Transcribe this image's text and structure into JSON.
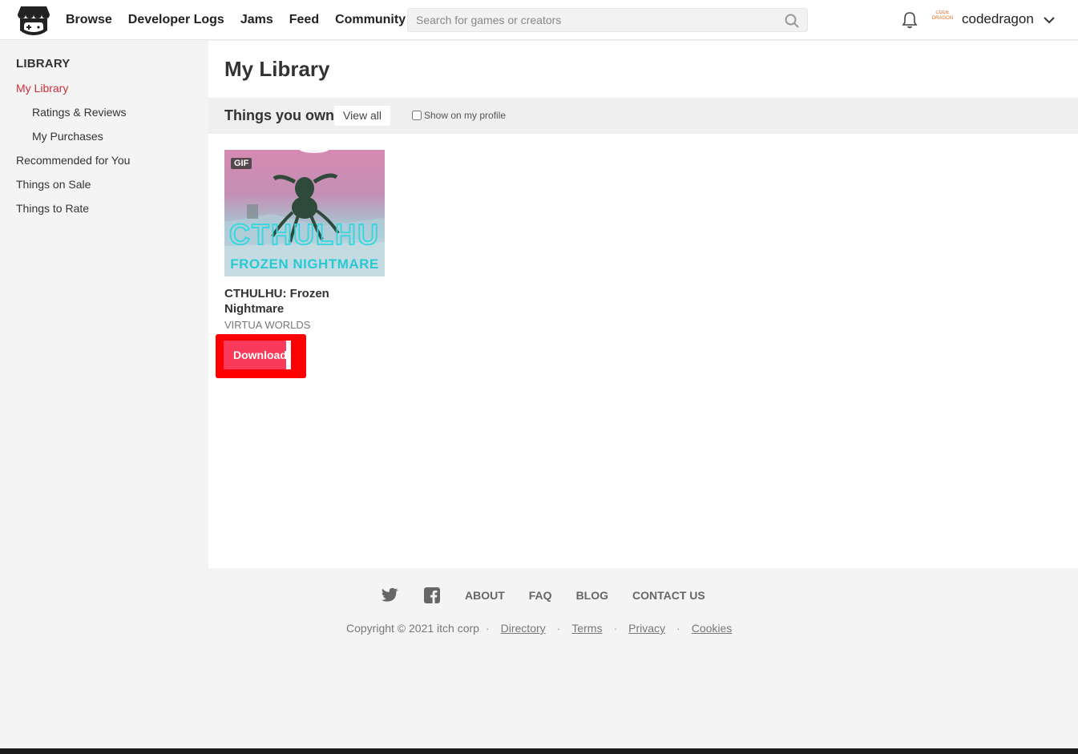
{
  "header": {
    "nav": [
      "Browse",
      "Developer Logs",
      "Jams",
      "Feed",
      "Community"
    ],
    "search_placeholder": "Search for games or creators",
    "username": "codedragon",
    "avatar_text": "CODE DRAGON"
  },
  "sidebar": {
    "title": "LIBRARY",
    "items": [
      {
        "label": "My Library",
        "active": true,
        "sub": false
      },
      {
        "label": "Ratings & Reviews",
        "active": false,
        "sub": true
      },
      {
        "label": "My Purchases",
        "active": false,
        "sub": true
      },
      {
        "label": "Recommended for You",
        "active": false,
        "sub": false
      },
      {
        "label": "Things on Sale",
        "active": false,
        "sub": false
      },
      {
        "label": "Things to Rate",
        "active": false,
        "sub": false
      }
    ]
  },
  "main": {
    "title": "My Library",
    "section_title": "Things you own",
    "view_all": "View all",
    "show_on_profile": "Show on my profile",
    "games": [
      {
        "badge": "GIF",
        "title": "CTHULHU: Frozen Nightmare",
        "author": "VIRTUA WORLDS",
        "action": "Download",
        "thumb_text_1": "CTHULHU",
        "thumb_text_2": "FROZEN NIGHTMARE"
      }
    ]
  },
  "footer": {
    "links": [
      "ABOUT",
      "FAQ",
      "BLOG",
      "CONTACT US"
    ],
    "copyright": "Copyright © 2021 itch corp",
    "legal": [
      "Directory",
      "Terms",
      "Privacy",
      "Cookies"
    ]
  },
  "colors": {
    "accent": "#c8303a",
    "download_button": "#fa3a5a",
    "highlight_box": "#ff0000"
  }
}
